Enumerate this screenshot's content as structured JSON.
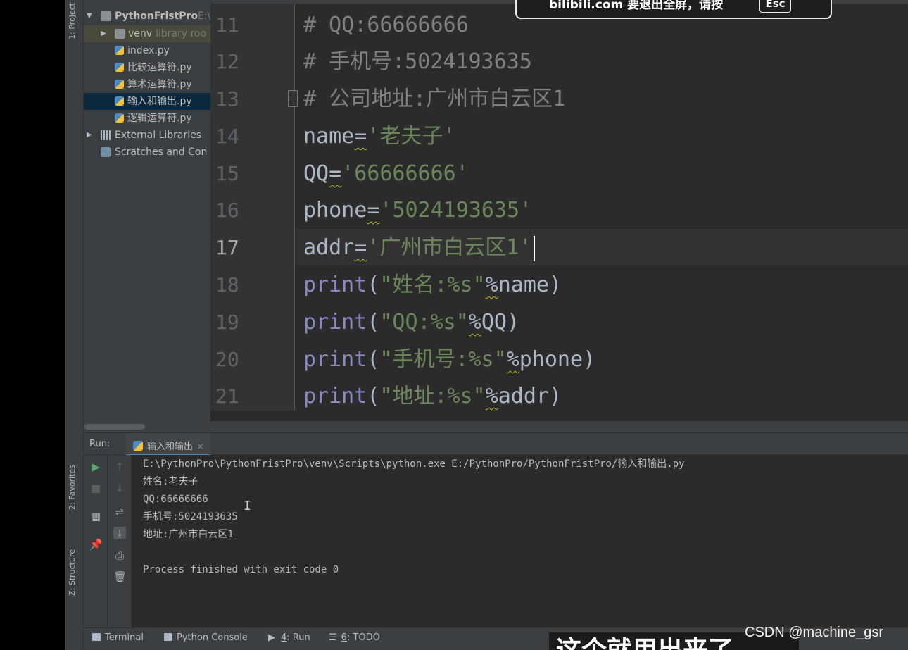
{
  "app": {
    "tool_windows_left": [
      "1: Project",
      "2: Favorites",
      "Z: Structure"
    ]
  },
  "project_tree": {
    "root": {
      "label": "PythonFristPro",
      "suffix": "E:\\"
    },
    "items": [
      {
        "label": "venv",
        "suffix": "library roo",
        "type": "folder"
      },
      {
        "label": "index.py",
        "type": "python"
      },
      {
        "label": "比较运算符.py",
        "type": "python"
      },
      {
        "label": "算术运算符.py",
        "type": "python"
      },
      {
        "label": "输入和输出.py",
        "type": "python",
        "selected": true
      },
      {
        "label": "逻辑运算符.py",
        "type": "python"
      },
      {
        "label": "External Libraries",
        "type": "libraries"
      },
      {
        "label": "Scratches and Con",
        "type": "scratches"
      }
    ]
  },
  "editor": {
    "current_line": "17",
    "lines": [
      {
        "num": "11",
        "text": "# QQ:66666666"
      },
      {
        "num": "12",
        "text": "# 手机号:5024193635"
      },
      {
        "num": "13",
        "text": "# 公司地址:广州市白云区1"
      },
      {
        "num": "14",
        "var": "name",
        "op": "=",
        "value": "'老夫子'"
      },
      {
        "num": "15",
        "var": "QQ",
        "op": "=",
        "value": "'66666666'"
      },
      {
        "num": "16",
        "var": "phone",
        "op": "=",
        "value": "'5024193635'"
      },
      {
        "num": "17",
        "var": "addr",
        "op": "=",
        "value": "'广州市白云区1'"
      },
      {
        "num": "18",
        "fn": "print",
        "open": "(",
        "fmt": "\"姓名:%s\"",
        "pct": "%",
        "arg": "name",
        "close": ")"
      },
      {
        "num": "19",
        "fn": "print",
        "open": "(",
        "fmt": "\"QQ:%s\"",
        "pct": "%",
        "arg": "QQ",
        "close": ")"
      },
      {
        "num": "20",
        "fn": "print",
        "open": "(",
        "fmt": "\"手机号:%s\"",
        "pct": "%",
        "arg": "phone",
        "close": ")"
      },
      {
        "num": "21",
        "fn": "print",
        "open": "(",
        "fmt": "\"地址:%s\"",
        "pct": "%",
        "arg": "addr",
        "close": ")"
      }
    ]
  },
  "run_panel": {
    "label": "Run:",
    "tab": "输入和输出",
    "output": [
      "E:\\PythonPro\\PythonFristPro\\venv\\Scripts\\python.exe E:/PythonPro/PythonFristPro/输入和输出.py",
      "姓名:老夫子",
      "QQ:66666666",
      "手机号:5024193635",
      "地址:广州市白云区1",
      "",
      "Process finished with exit code 0"
    ]
  },
  "bottom_bar": {
    "terminal": "Terminal",
    "python_console": "Python Console",
    "run_num": "4",
    "run_label": ": Run",
    "todo_num": "6",
    "todo_label": ": TODO"
  },
  "overlay": {
    "notice": "bilibili.com 要退出全屏，请按",
    "esc": "Esc",
    "subtitle": "这个就用出来了",
    "watermark": "CSDN @machine_gsr"
  }
}
